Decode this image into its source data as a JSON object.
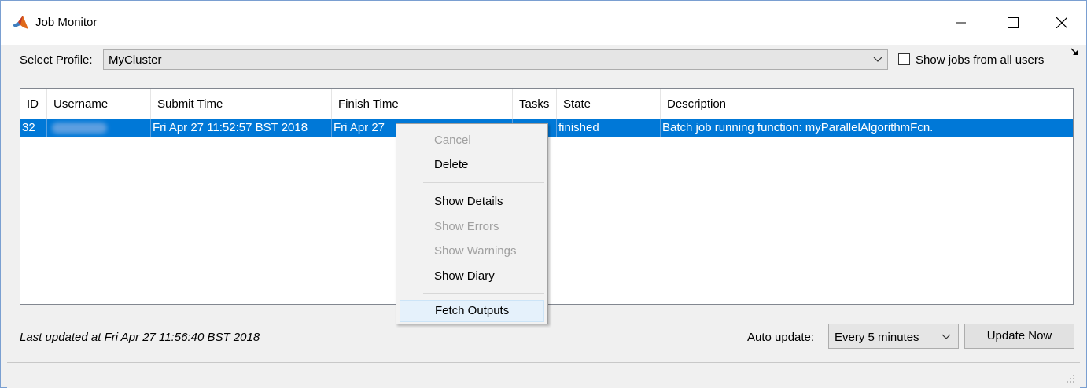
{
  "window": {
    "title": "Job Monitor"
  },
  "profile": {
    "label": "Select Profile:",
    "selected": "MyCluster",
    "show_all_users_label": "Show jobs from all users",
    "show_all_users_checked": false
  },
  "table": {
    "columns": [
      "ID",
      "Username",
      "Submit Time",
      "Finish Time",
      "Tasks",
      "State",
      "Description"
    ],
    "rows": [
      {
        "id": "32",
        "username": "",
        "submit_time": "Fri Apr 27 11:52:57 BST 2018",
        "finish_time": "Fri Apr 27",
        "tasks": "",
        "state": "finished",
        "description": "Batch job running function: myParallelAlgorithmFcn."
      }
    ]
  },
  "context_menu": {
    "items": [
      {
        "label": "Cancel",
        "enabled": false
      },
      {
        "label": "Delete",
        "enabled": true
      },
      {
        "label": "Show Details",
        "enabled": true
      },
      {
        "label": "Show Errors",
        "enabled": false
      },
      {
        "label": "Show Warnings",
        "enabled": false
      },
      {
        "label": "Show Diary",
        "enabled": true
      },
      {
        "label": "Fetch Outputs",
        "enabled": true,
        "highlighted": true
      }
    ]
  },
  "footer": {
    "last_updated": "Last updated at Fri Apr 27 11:56:40 BST 2018",
    "auto_update_label": "Auto update:",
    "auto_update_value": "Every 5 minutes",
    "update_now_label": "Update Now"
  },
  "colors": {
    "selection": "#0078d7",
    "menu_highlight": "#e5f1fb",
    "disabled_text": "#a0a0a0"
  }
}
